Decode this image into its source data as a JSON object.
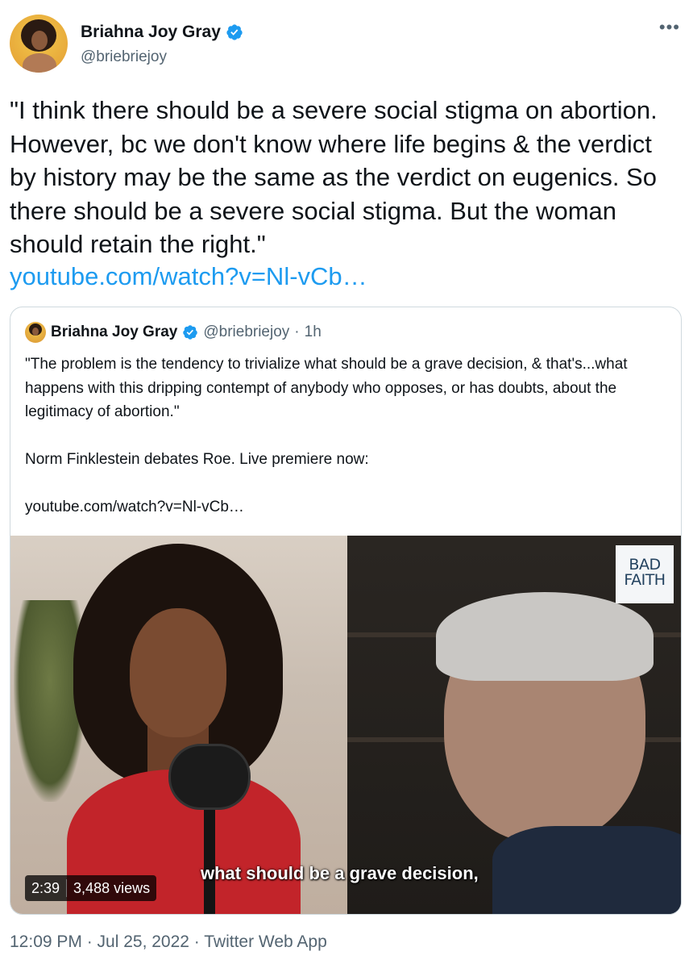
{
  "tweet": {
    "author_name": "Briahna Joy Gray",
    "author_handle": "@briebriejoy",
    "more_icon": "more-horizontal-icon",
    "text": "\"I think there should be a severe social stigma on abortion. However, bc we don't know where life begins & the verdict by history may be the same as the verdict on eugenics. So there should be a severe social stigma. But the woman should retain the right.\"",
    "link": "youtube.com/watch?v=Nl-vCb…",
    "meta": "12:09 PM · Jul 25, 2022 · Twitter Web App"
  },
  "quoted": {
    "author_name": "Briahna Joy Gray",
    "author_handle": "@briebriejoy",
    "dot": "·",
    "time": "1h",
    "text_1": "\"The problem is the tendency to trivialize what should be a grave decision, & that's...what happens with this dripping contempt of anybody who opposes, or has doubts, about the legitimacy of abortion.\"",
    "text_2": "Norm Finklestein debates Roe. Live premiere now:",
    "text_3": "youtube.com/watch?v=Nl-vCb…"
  },
  "video": {
    "duration": "2:39",
    "views": "3,488 views",
    "subtitle": "what should be a grave decision,",
    "brand_logo": "BAD FAITH"
  },
  "colors": {
    "link": "#1d9bf0",
    "secondary_text": "#536471",
    "verified": "#1d9bf0"
  }
}
